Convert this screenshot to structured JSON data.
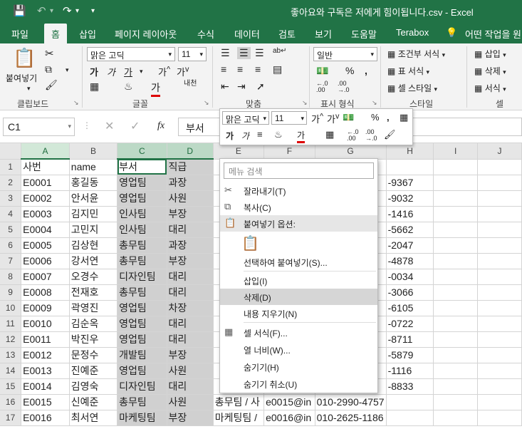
{
  "titlebar": {
    "title": "좋아요와 구독은 저에게 힘이됩니다.csv  -  Excel"
  },
  "tabs": [
    "파일",
    "홈",
    "삽입",
    "페이지 레이아웃",
    "수식",
    "데이터",
    "검토",
    "보기",
    "도움말",
    "Terabox",
    "어떤 작업을 원"
  ],
  "ribbon": {
    "paste_label": "붙여넣기",
    "clipboard_label": "클립보드",
    "font_name": "맑은 고딕",
    "font_size": "11",
    "font_group_label": "글꼴",
    "align_group_label": "맞춤",
    "number_format": "일반",
    "number_group_label": "표시 형식",
    "cond_format": "조건부 서식",
    "table_format": "표 서식",
    "cell_style": "셀 스타일",
    "style_group_label": "스타일",
    "insert": "삽입",
    "delete": "삭제",
    "format": "서식",
    "cells_group_label": "셀"
  },
  "formula_bar": {
    "name_box": "C1",
    "fx": "fx",
    "value": "부서"
  },
  "minibar": {
    "font_name": "맑은 고딕",
    "font_size": "11"
  },
  "columns": [
    "A",
    "B",
    "C",
    "D",
    "E",
    "F",
    "G",
    "H",
    "I",
    "J"
  ],
  "rows": [
    {
      "n": "1",
      "a": "사번",
      "b": "name",
      "c": "부서",
      "d": "직급",
      "h": ""
    },
    {
      "n": "2",
      "a": "E0001",
      "b": "홍길동",
      "c": "영업팀",
      "d": "과장",
      "h": "-9367"
    },
    {
      "n": "3",
      "a": "E0002",
      "b": "안서윤",
      "c": "영업팀",
      "d": "사원",
      "h": "-9032"
    },
    {
      "n": "4",
      "a": "E0003",
      "b": "김지민",
      "c": "인사팀",
      "d": "부장",
      "h": "-1416"
    },
    {
      "n": "5",
      "a": "E0004",
      "b": "고민지",
      "c": "인사팀",
      "d": "대리",
      "h": "-5662"
    },
    {
      "n": "6",
      "a": "E0005",
      "b": "김상현",
      "c": "총무팀",
      "d": "과장",
      "h": "-2047"
    },
    {
      "n": "7",
      "a": "E0006",
      "b": "강서연",
      "c": "총무팀",
      "d": "부장",
      "h": "-4878"
    },
    {
      "n": "8",
      "a": "E0007",
      "b": "오경수",
      "c": "디자인팀",
      "d": "대리",
      "h": "-0034"
    },
    {
      "n": "9",
      "a": "E0008",
      "b": "전재호",
      "c": "총무팀",
      "d": "대리",
      "h": "-3066"
    },
    {
      "n": "10",
      "a": "E0009",
      "b": "곽영진",
      "c": "영업팀",
      "d": "차장",
      "h": "-6105"
    },
    {
      "n": "11",
      "a": "E0010",
      "b": "김순옥",
      "c": "영업팀",
      "d": "대리",
      "h": "-0722"
    },
    {
      "n": "12",
      "a": "E0011",
      "b": "박진우",
      "c": "영업팀",
      "d": "대리",
      "h": "-8711"
    },
    {
      "n": "13",
      "a": "E0012",
      "b": "문정수",
      "c": "개발팀",
      "d": "부장",
      "h": "-5879"
    },
    {
      "n": "14",
      "a": "E0013",
      "b": "진예준",
      "c": "영업팀",
      "d": "사원",
      "h": "-1116"
    },
    {
      "n": "15",
      "a": "E0014",
      "b": "김영숙",
      "c": "디자인팀",
      "d": "대리",
      "h": "-8833"
    },
    {
      "n": "16",
      "a": "E0015",
      "b": "신예준",
      "c": "총무팀",
      "d": "사원",
      "e": "총무팀 / 사",
      "f": "e0015@in",
      "g": "010-2990-4757"
    },
    {
      "n": "17",
      "a": "E0016",
      "b": "최서연",
      "c": "마케팅팀",
      "d": "부장",
      "e": "마케팅팀 /",
      "f": "e0016@in",
      "g": "010-2625-1186"
    }
  ],
  "context_menu": {
    "search_placeholder": "메뉴 검색",
    "cut": "잘라내기(T)",
    "copy": "복사(C)",
    "paste_options": "붙여넣기 옵션:",
    "paste_special": "선택하여 붙여넣기(S)...",
    "insert": "삽입(I)",
    "delete": "삭제(D)",
    "clear": "내용 지우기(N)",
    "format_cells": "셀 서식(F)...",
    "col_width": "열 너비(W)...",
    "hide": "숨기기(H)",
    "unhide": "숨기기 취소(U)"
  }
}
